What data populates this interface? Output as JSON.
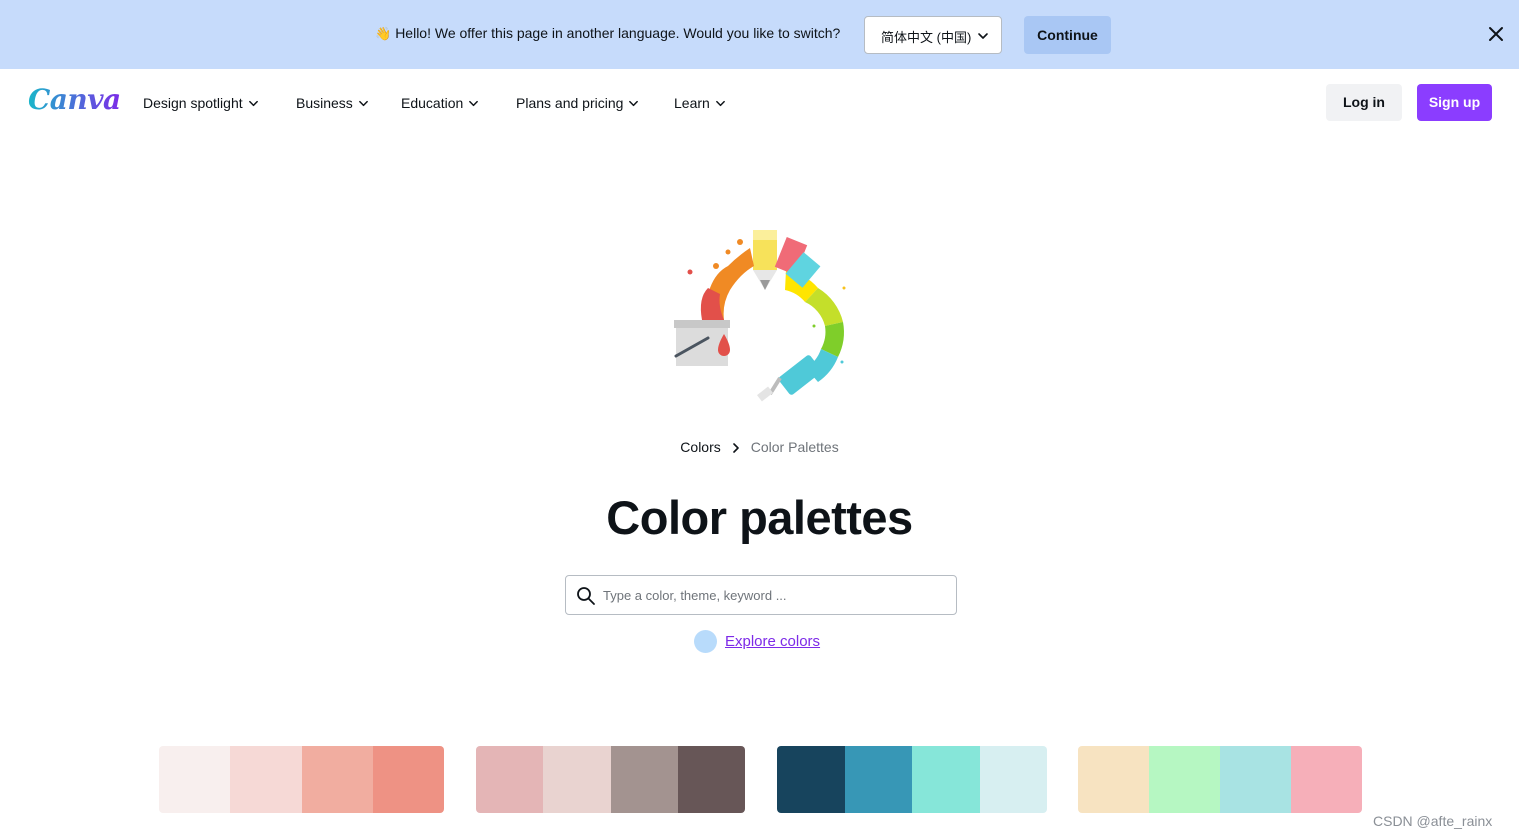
{
  "banner": {
    "message": "Hello! We offer this page in another language. Would you like to switch?",
    "language_value": "简体中文 (中国)",
    "continue_label": "Continue"
  },
  "nav": {
    "logo": "Canva",
    "items": [
      {
        "label": "Design spotlight"
      },
      {
        "label": "Business"
      },
      {
        "label": "Education"
      },
      {
        "label": "Plans and pricing"
      },
      {
        "label": "Learn"
      }
    ],
    "login_label": "Log in",
    "signup_label": "Sign up"
  },
  "breadcrumb": {
    "items": [
      "Colors",
      "Color Palettes"
    ]
  },
  "page_title": "Color palettes",
  "search": {
    "value": "",
    "placeholder": "Type a color, theme, keyword ..."
  },
  "explore": {
    "label": "Explore colors",
    "dot_color": "#b8dbfb"
  },
  "palettes": [
    {
      "colors": [
        "#f8efee",
        "#f6d9d6",
        "#f1ada0",
        "#ee9284"
      ]
    },
    {
      "colors": [
        "#e4b5b6",
        "#e9d3d0",
        "#a39390",
        "#675657"
      ]
    },
    {
      "colors": [
        "#17445d",
        "#3797b6",
        "#86e6d9",
        "#d7eff1"
      ]
    },
    {
      "colors": [
        "#f7e3c1",
        "#b6f7c2",
        "#a8e3e3",
        "#f6afb9"
      ]
    }
  ],
  "colors": {
    "banner_bg": "#c6dbfb",
    "signup_bg": "#8b3dff",
    "link": "#7d2ae8"
  },
  "watermark": "CSDN @afte_rainx"
}
